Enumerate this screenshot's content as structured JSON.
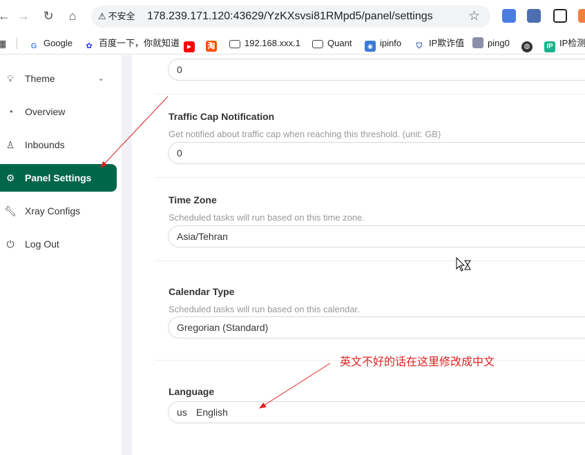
{
  "browser": {
    "security_label": "不安全",
    "url": "178.239.171.120:43629/YzKXsvsi81RMpd5/panel/settings",
    "bookmarks": [
      "Google",
      "百度一下，你就知道",
      "192.168.xxx.1",
      "Quant",
      "ipinfo",
      "IP欺诈值",
      "ping0",
      "IP检测"
    ]
  },
  "sidebar": {
    "items": [
      {
        "label": "Theme"
      },
      {
        "label": "Overview"
      },
      {
        "label": "Inbounds"
      },
      {
        "label": "Panel Settings"
      },
      {
        "label": "Xray Configs"
      },
      {
        "label": "Log Out"
      }
    ]
  },
  "settings": {
    "top_value": "0",
    "traffic_cap": {
      "title": "Traffic Cap Notification",
      "desc": "Get notified about traffic cap when reaching this threshold. (unit: GB)",
      "value": "0"
    },
    "time_zone": {
      "title": "Time Zone",
      "desc": "Scheduled tasks will run based on this time zone.",
      "value": "Asia/Tehran"
    },
    "calendar": {
      "title": "Calendar Type",
      "desc": "Scheduled tasks will run based on this calendar.",
      "value": "Gregorian (Standard)"
    },
    "language": {
      "title": "Language",
      "flag": "us",
      "value": "English"
    }
  },
  "annotation": {
    "text": "英文不好的话在这里修改成中文",
    "color": "#e02020"
  },
  "colors": {
    "accent": "#00664a"
  }
}
